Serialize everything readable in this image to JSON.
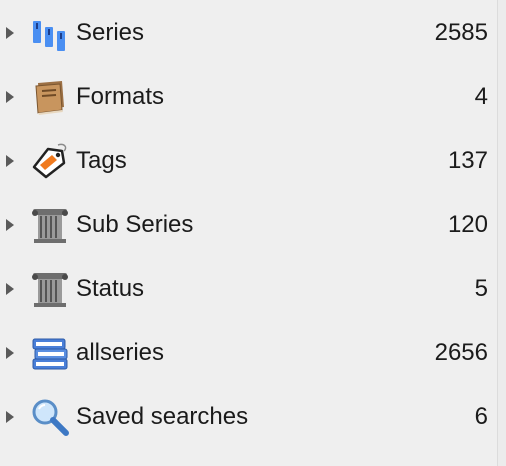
{
  "tag_browser": {
    "items": [
      {
        "label": "Series",
        "count": "2585",
        "icon": "series-icon"
      },
      {
        "label": "Formats",
        "count": "4",
        "icon": "book-icon"
      },
      {
        "label": "Tags",
        "count": "137",
        "icon": "tag-icon"
      },
      {
        "label": "Sub Series",
        "count": "120",
        "icon": "column-icon"
      },
      {
        "label": "Status",
        "count": "5",
        "icon": "column-icon"
      },
      {
        "label": "allseries",
        "count": "2656",
        "icon": "books-stack-icon"
      },
      {
        "label": "Saved searches",
        "count": "6",
        "icon": "search-icon"
      }
    ]
  }
}
